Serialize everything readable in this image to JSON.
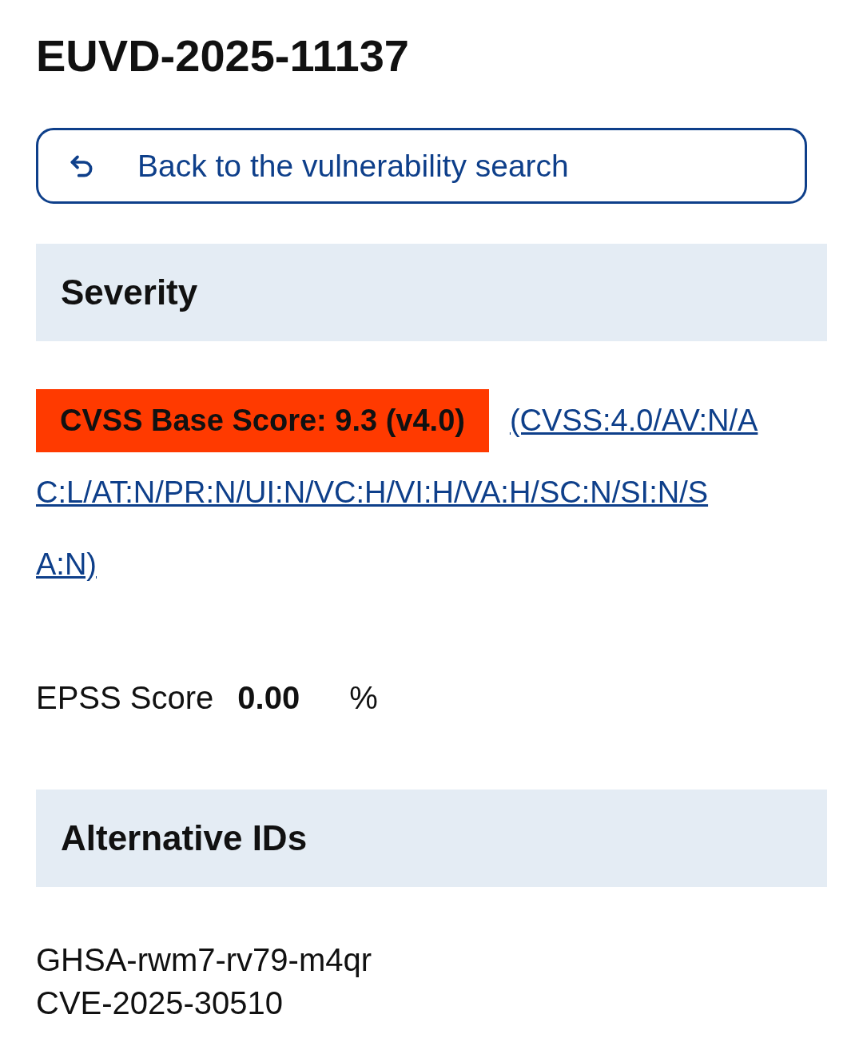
{
  "title": "EUVD-2025-11137",
  "back_button": {
    "label": "Back to the vulnerability search"
  },
  "severity": {
    "heading": "Severity",
    "cvss_badge": "CVSS Base Score: 9.3 (v4.0)",
    "vector_link_lines": [
      "(CVSS:4.0/AV:N/A",
      "C:L/AT:N/PR:N/UI:N/VC:H/VI:H/VA:H/SC:N/SI:N/S",
      "A:N)"
    ],
    "epss": {
      "label": "EPSS Score",
      "value": "0.00",
      "unit": "%"
    }
  },
  "alternative_ids": {
    "heading": "Alternative IDs",
    "ids": [
      "GHSA-rwm7-rv79-m4qr",
      "CVE-2025-30510"
    ]
  }
}
